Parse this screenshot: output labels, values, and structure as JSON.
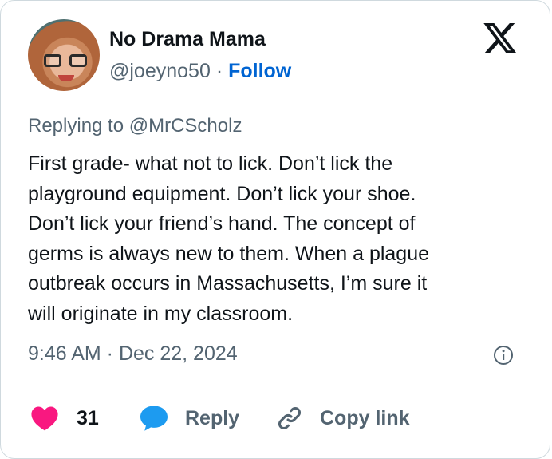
{
  "author": {
    "name": "No Drama Mama",
    "handle": "@joeyno50",
    "separator": "·",
    "follow_label": "Follow"
  },
  "tweet": {
    "replying_to": "Replying to @MrCScholz",
    "text_lines": [
      "First grade- what not to lick. Don’t lick the",
      "playground equipment. Don’t lick your shoe.",
      "Don’t lick your friend’s hand. The concept of",
      "germs is always new to them. When a plague",
      "outbreak occurs in Massachusetts, I’m sure it",
      "will originate in my classroom."
    ],
    "timestamp": "9:46 AM · Dec 22, 2024"
  },
  "actions": {
    "like_count": "31",
    "reply_label": "Reply",
    "copy_link_label": "Copy link"
  },
  "colors": {
    "like_red": "#f91880",
    "reply_blue": "#1d9bf0",
    "follow_blue": "#0064d2",
    "muted": "#536471"
  },
  "icons": [
    "x-logo-icon",
    "info-icon",
    "heart-icon",
    "speech-bubble-icon",
    "link-icon"
  ]
}
